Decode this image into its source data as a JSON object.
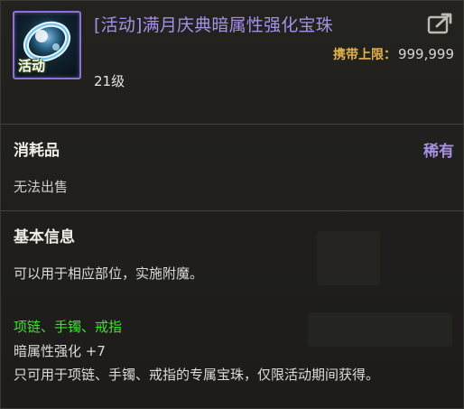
{
  "item": {
    "title": "[活动]满月庆典暗属性强化宝珠",
    "icon_badge": "活动",
    "icon_name": "orb-icon",
    "level": "21级",
    "carry_limit_label": "携带上限：",
    "carry_limit_value": "999,999"
  },
  "category": {
    "label": "消耗品",
    "rarity": "稀有",
    "trade_status": "无法出售"
  },
  "info": {
    "heading": "基本信息",
    "usage": "可以用于相应部位，实施附魔。",
    "slots": "项链、手镯、戒指",
    "effect": "暗属性强化 +7",
    "note": "只可用于项链、手镯、戒指的专属宝珠，仅限活动期间获得。"
  },
  "colors": {
    "title": "#a68fe6",
    "rarity": "#a68fe6",
    "limit_label": "#e3b34b",
    "slots": "#3ee02e",
    "frame": "#8b72d6"
  }
}
